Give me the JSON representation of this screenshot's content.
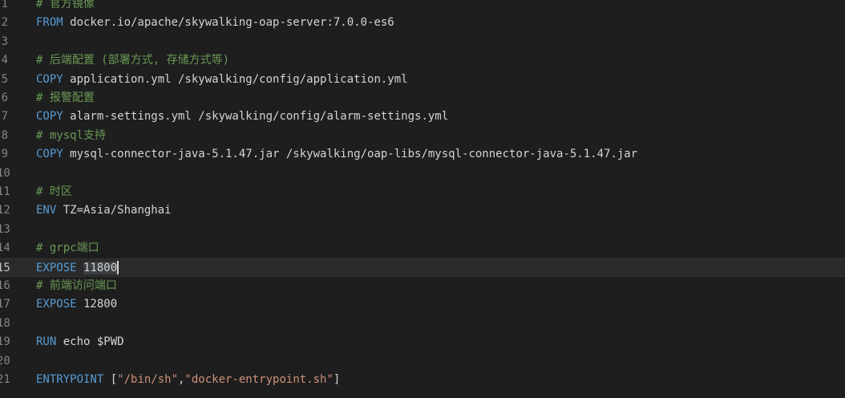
{
  "editor": {
    "lines": [
      {
        "num": "1",
        "parts": [
          {
            "t": "# 官方镜像",
            "c": "cmt"
          }
        ]
      },
      {
        "num": "2",
        "parts": [
          {
            "t": "FROM",
            "c": "kw"
          },
          {
            "t": " docker.io/apache/skywalking-oap-server:7.0.0-es6",
            "c": "txt"
          }
        ]
      },
      {
        "num": "3",
        "parts": []
      },
      {
        "num": "4",
        "parts": [
          {
            "t": "# 后端配置 (部署方式, 存储方式等)",
            "c": "cmt"
          }
        ]
      },
      {
        "num": "5",
        "parts": [
          {
            "t": "COPY",
            "c": "kw"
          },
          {
            "t": " application.yml /skywalking/config/application.yml",
            "c": "txt"
          }
        ]
      },
      {
        "num": "6",
        "parts": [
          {
            "t": "# 报警配置",
            "c": "cmt"
          }
        ]
      },
      {
        "num": "7",
        "parts": [
          {
            "t": "COPY",
            "c": "kw"
          },
          {
            "t": " alarm-settings.yml /skywalking/config/alarm-settings.yml",
            "c": "txt"
          }
        ]
      },
      {
        "num": "8",
        "parts": [
          {
            "t": "# mysql支持",
            "c": "cmt"
          }
        ]
      },
      {
        "num": "9",
        "parts": [
          {
            "t": "COPY",
            "c": "kw"
          },
          {
            "t": " mysql-connector-java-5.1.47.jar /skywalking/oap-libs/mysql-connector-java-5.1.47.jar",
            "c": "txt"
          }
        ]
      },
      {
        "num": "10",
        "parts": []
      },
      {
        "num": "11",
        "parts": [
          {
            "t": "# 时区",
            "c": "cmt"
          }
        ]
      },
      {
        "num": "12",
        "parts": [
          {
            "t": "ENV",
            "c": "kw"
          },
          {
            "t": " TZ=Asia/Shanghai",
            "c": "txt"
          }
        ]
      },
      {
        "num": "13",
        "parts": []
      },
      {
        "num": "14",
        "parts": [
          {
            "t": "# grpc端口",
            "c": "cmt"
          }
        ]
      },
      {
        "num": "15",
        "parts": [
          {
            "t": "EXPOSE",
            "c": "kw"
          },
          {
            "t": " ",
            "c": "txt"
          },
          {
            "t": "11800",
            "c": "sel"
          }
        ],
        "current": true
      },
      {
        "num": "16",
        "parts": [
          {
            "t": "# 前端访问端口",
            "c": "cmt"
          }
        ]
      },
      {
        "num": "17",
        "parts": [
          {
            "t": "EXPOSE",
            "c": "kw"
          },
          {
            "t": " 12800",
            "c": "txt"
          }
        ]
      },
      {
        "num": "18",
        "parts": []
      },
      {
        "num": "19",
        "parts": [
          {
            "t": "RUN",
            "c": "kw"
          },
          {
            "t": " echo $PWD",
            "c": "txt"
          }
        ]
      },
      {
        "num": "20",
        "parts": []
      },
      {
        "num": "21",
        "parts": [
          {
            "t": "ENTRYPOINT",
            "c": "kw"
          },
          {
            "t": " [",
            "c": "txt"
          },
          {
            "t": "\"/bin/sh\"",
            "c": "str"
          },
          {
            "t": ",",
            "c": "txt"
          },
          {
            "t": "\"docker-entrypoint.sh\"",
            "c": "str"
          },
          {
            "t": "]",
            "c": "txt"
          }
        ]
      }
    ]
  }
}
